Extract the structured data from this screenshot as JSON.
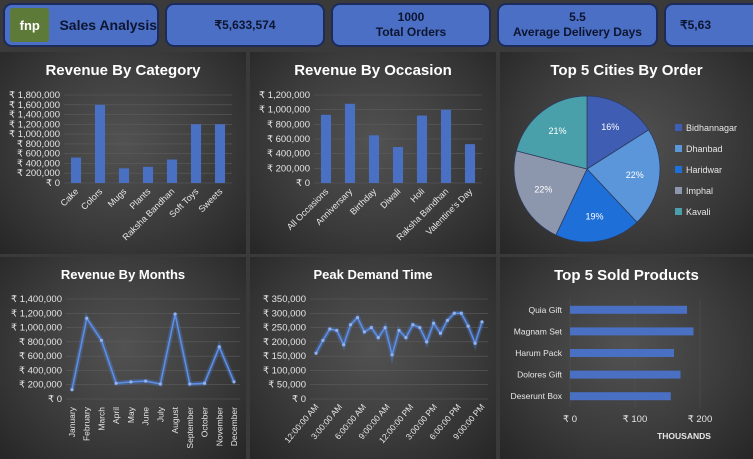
{
  "brand": {
    "logo_text": "fnp",
    "title": "Sales Analysis"
  },
  "kpis": [
    {
      "value": "₹5,633,574",
      "label": ""
    },
    {
      "value": "1000",
      "label": "Total Orders"
    },
    {
      "value": "5.5",
      "label": "Average Delivery Days"
    },
    {
      "value": "₹5,63",
      "label": ""
    }
  ],
  "colors": {
    "bar": "#4a70c4",
    "kpi_bg": "#4a6fc4",
    "line": "#5b8ee6"
  },
  "currency": "₹",
  "chart_data": [
    {
      "id": "category",
      "type": "bar",
      "title": "Revenue By Category",
      "categories": [
        "Cake",
        "Colors",
        "Mugs",
        "Plants",
        "Raksha Bandhan",
        "Soft Toys",
        "Sweets"
      ],
      "values": [
        520000,
        1600000,
        300000,
        330000,
        480000,
        1200000,
        1200000
      ],
      "ylim": [
        0,
        1800000
      ],
      "yticks": [
        "0",
        "200,000",
        "400,000",
        "600,000",
        "800,000",
        "1,000,000",
        "1,200,000",
        "1,400,000",
        "1,600,000",
        "1,800,000"
      ]
    },
    {
      "id": "occasion",
      "type": "bar",
      "title": "Revenue By Occasion",
      "categories": [
        "All Occasions",
        "Anniversary",
        "Birthday",
        "Diwali",
        "Holi",
        "Raksha Bandhan",
        "Valentine's Day"
      ],
      "values": [
        930000,
        1080000,
        650000,
        490000,
        920000,
        1000000,
        530000
      ],
      "ylim": [
        0,
        1200000
      ],
      "yticks": [
        "0",
        "200,000",
        "400,000",
        "600,000",
        "800,000",
        "1,000,000",
        "1,200,000"
      ]
    },
    {
      "id": "cities",
      "type": "pie",
      "title": "Top 5 Cities By Order",
      "labels": [
        "Bidhannagar",
        "Dhanbad",
        "Haridwar",
        "Imphal",
        "Kavali"
      ],
      "values": [
        16,
        22,
        19,
        22,
        21
      ],
      "value_labels": [
        "16%",
        "22%",
        "19%",
        "22%",
        "21%"
      ],
      "colors": [
        "#3f5db3",
        "#5a96d9",
        "#1e6fd8",
        "#8c96ad",
        "#4aa0aa"
      ]
    },
    {
      "id": "months",
      "type": "line",
      "title": "Revenue By Months",
      "categories": [
        "January",
        "February",
        "March",
        "April",
        "May",
        "June",
        "July",
        "August",
        "September",
        "October",
        "November",
        "December"
      ],
      "values": [
        130000,
        1130000,
        820000,
        220000,
        240000,
        250000,
        210000,
        1190000,
        210000,
        220000,
        730000,
        240000
      ],
      "ylim": [
        0,
        1400000
      ],
      "yticks": [
        "0",
        "200,000",
        "400,000",
        "600,000",
        "800,000",
        "1,000,000",
        "1,200,000",
        "1,400,000"
      ]
    },
    {
      "id": "peak",
      "type": "line",
      "title": "Peak Demand Time",
      "xticks": [
        "12:00:00 AM",
        "3:00:00 AM",
        "6:00:00 AM",
        "9:00:00 AM",
        "12:00:00 PM",
        "3:00:00 PM",
        "6:00:00 PM",
        "9:00:00 PM"
      ],
      "values": [
        160000,
        205000,
        245000,
        240000,
        190000,
        260000,
        285000,
        235000,
        250000,
        215000,
        250000,
        155000,
        240000,
        215000,
        260000,
        250000,
        200000,
        265000,
        230000,
        275000,
        300000,
        300000,
        255000,
        195000,
        270000
      ],
      "ylim": [
        0,
        350000
      ],
      "yticks": [
        "0",
        "50,000",
        "100,000",
        "150,000",
        "200,000",
        "250,000",
        "300,000",
        "350,000"
      ]
    },
    {
      "id": "products",
      "type": "bar",
      "orientation": "horizontal",
      "title": "Top 5 Sold Products",
      "categories": [
        "Quia Gift",
        "Magnam Set",
        "Harum Pack",
        "Dolores Gift",
        "Deserunt Box"
      ],
      "values": [
        180,
        190,
        160,
        170,
        155
      ],
      "xlim": [
        0,
        200
      ],
      "xticks": [
        "0",
        "100",
        "200"
      ],
      "xlabel": "THOUSANDS"
    }
  ]
}
